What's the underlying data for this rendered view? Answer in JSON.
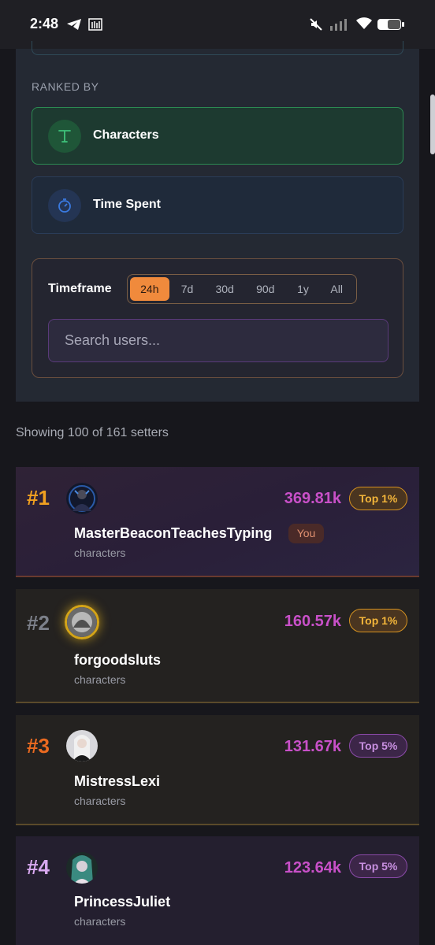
{
  "status_bar": {
    "time": "2:48"
  },
  "ranked_by": {
    "label": "RANKED BY",
    "options": [
      {
        "icon": "text-t-icon",
        "label": "Characters",
        "selected": true
      },
      {
        "icon": "stopwatch-icon",
        "label": "Time Spent",
        "selected": false
      }
    ]
  },
  "timeframe": {
    "label": "Timeframe",
    "options": [
      "24h",
      "7d",
      "30d",
      "90d",
      "1y",
      "All"
    ],
    "selected": "24h"
  },
  "search": {
    "placeholder": "Search users..."
  },
  "showing_text": "Showing 100 of 161 setters",
  "leaderboard": [
    {
      "rank": "#1",
      "username": "MasterBeaconTeachesTyping",
      "unit": "characters",
      "score": "369.81k",
      "badge": "Top 1%",
      "you_label": "You"
    },
    {
      "rank": "#2",
      "username": "forgoodsluts",
      "unit": "characters",
      "score": "160.57k",
      "badge": "Top 1%"
    },
    {
      "rank": "#3",
      "username": "MistressLexi",
      "unit": "characters",
      "score": "131.67k",
      "badge": "Top 5%"
    },
    {
      "rank": "#4",
      "username": "PrincessJuliet",
      "unit": "characters",
      "score": "123.64k",
      "badge": "Top 5%"
    }
  ],
  "colors": {
    "accent_orange": "#f08a3c",
    "score_magenta": "#c850c8",
    "gold": "#f0a020"
  }
}
